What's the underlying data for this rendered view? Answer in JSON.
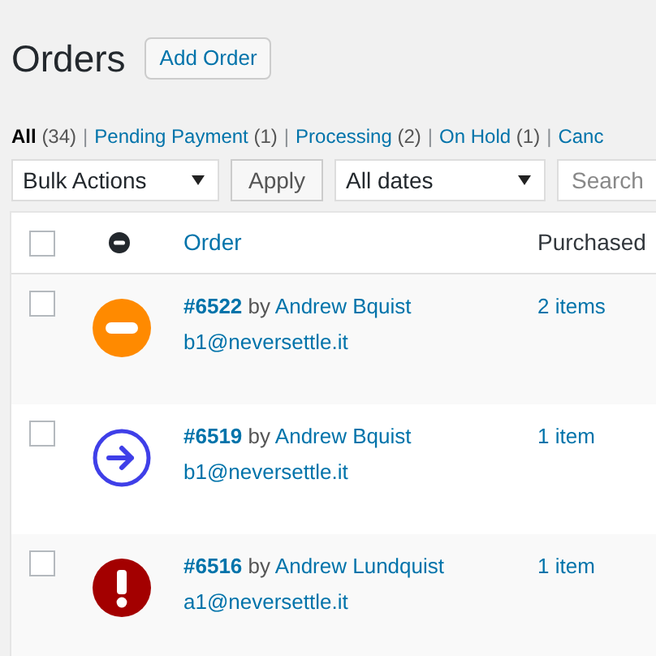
{
  "page_title": "Orders",
  "add_button": "Add Order",
  "filters": [
    {
      "label": "All",
      "count": "(34)",
      "selected": true
    },
    {
      "separator": "|",
      "label": "Pending Payment",
      "count": "(1)",
      "selected": false
    },
    {
      "separator": "|",
      "label": "Processing",
      "count": "(2)",
      "selected": false
    },
    {
      "separator": "|",
      "label": "On Hold",
      "count": "(1)",
      "selected": false
    },
    {
      "separator": "|",
      "label": "Canc",
      "selected": false
    }
  ],
  "bulk_actions": "Bulk Actions",
  "apply_button": "Apply",
  "date_filter": "All dates",
  "search": {
    "placeholder": "Search"
  },
  "table": {
    "columns": [
      {
        "kind": "checkbox",
        "checked": false
      },
      {
        "kind": "status-icon"
      },
      {
        "kind": "text",
        "label": "Order"
      },
      {
        "kind": "text",
        "label": "Purchased"
      }
    ],
    "rows": [
      {
        "checked": false,
        "kind": "minus",
        "color": "#ff8a00",
        "order": "#6522",
        "by": "by",
        "customer": "Andrew Bquist",
        "email": "b1@neversettle.it",
        "purchased": "2 items"
      },
      {
        "checked": false,
        "kind": "arrow",
        "color": "#3f3fe8",
        "order": "#6519",
        "by": "by",
        "customer": "Andrew Bquist",
        "email": "b1@neversettle.it",
        "purchased": "1 item"
      },
      {
        "checked": false,
        "kind": "exclamation",
        "color": "#a30000",
        "order": "#6516",
        "by": "by",
        "customer": "Andrew Lundquist",
        "email": "a1@neversettle.it",
        "purchased": "1 item"
      }
    ]
  }
}
